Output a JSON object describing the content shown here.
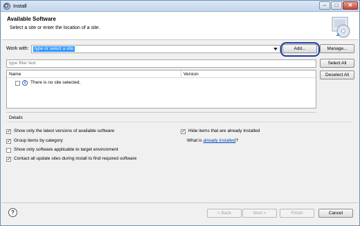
{
  "window": {
    "title": "Install",
    "controls": {
      "minimize": "–",
      "maximize": "□",
      "close": "✕"
    }
  },
  "header": {
    "title": "Available Software",
    "subtitle": "Select a site or enter the location of a site."
  },
  "work_with": {
    "label": "Work with:",
    "value": "type or select a site",
    "add_label": "Add...",
    "manage_label": "Manage..."
  },
  "filter": {
    "placeholder": "type filter text"
  },
  "side_buttons": {
    "select_all": "Select All",
    "deselect_all": "Deselect All"
  },
  "table": {
    "columns": [
      "Name",
      "Version"
    ],
    "rows": [
      {
        "name": "There is no site selected.",
        "checked": false
      }
    ]
  },
  "details": {
    "label": "Details"
  },
  "options": {
    "left": [
      {
        "label": "Show only the latest versions of available software",
        "checked": true
      },
      {
        "label": "Group items by category",
        "checked": true
      },
      {
        "label": "Show only software applicable to target environment",
        "checked": false
      },
      {
        "label": "Contact all update sites during install to find required software",
        "checked": true
      }
    ],
    "right": {
      "hide_installed": {
        "label": "Hide items that are already installed",
        "checked": true
      },
      "what_is_prefix": "What is",
      "what_is_link": "already installed",
      "what_is_suffix": "?"
    }
  },
  "footer": {
    "back": "< Back",
    "next": "Next >",
    "finish": "Finish",
    "cancel": "Cancel",
    "help_icon": "?"
  },
  "colors": {
    "accent_selection": "#3399ff",
    "add_highlight": "#1f3b9a",
    "link": "#0645ad"
  }
}
